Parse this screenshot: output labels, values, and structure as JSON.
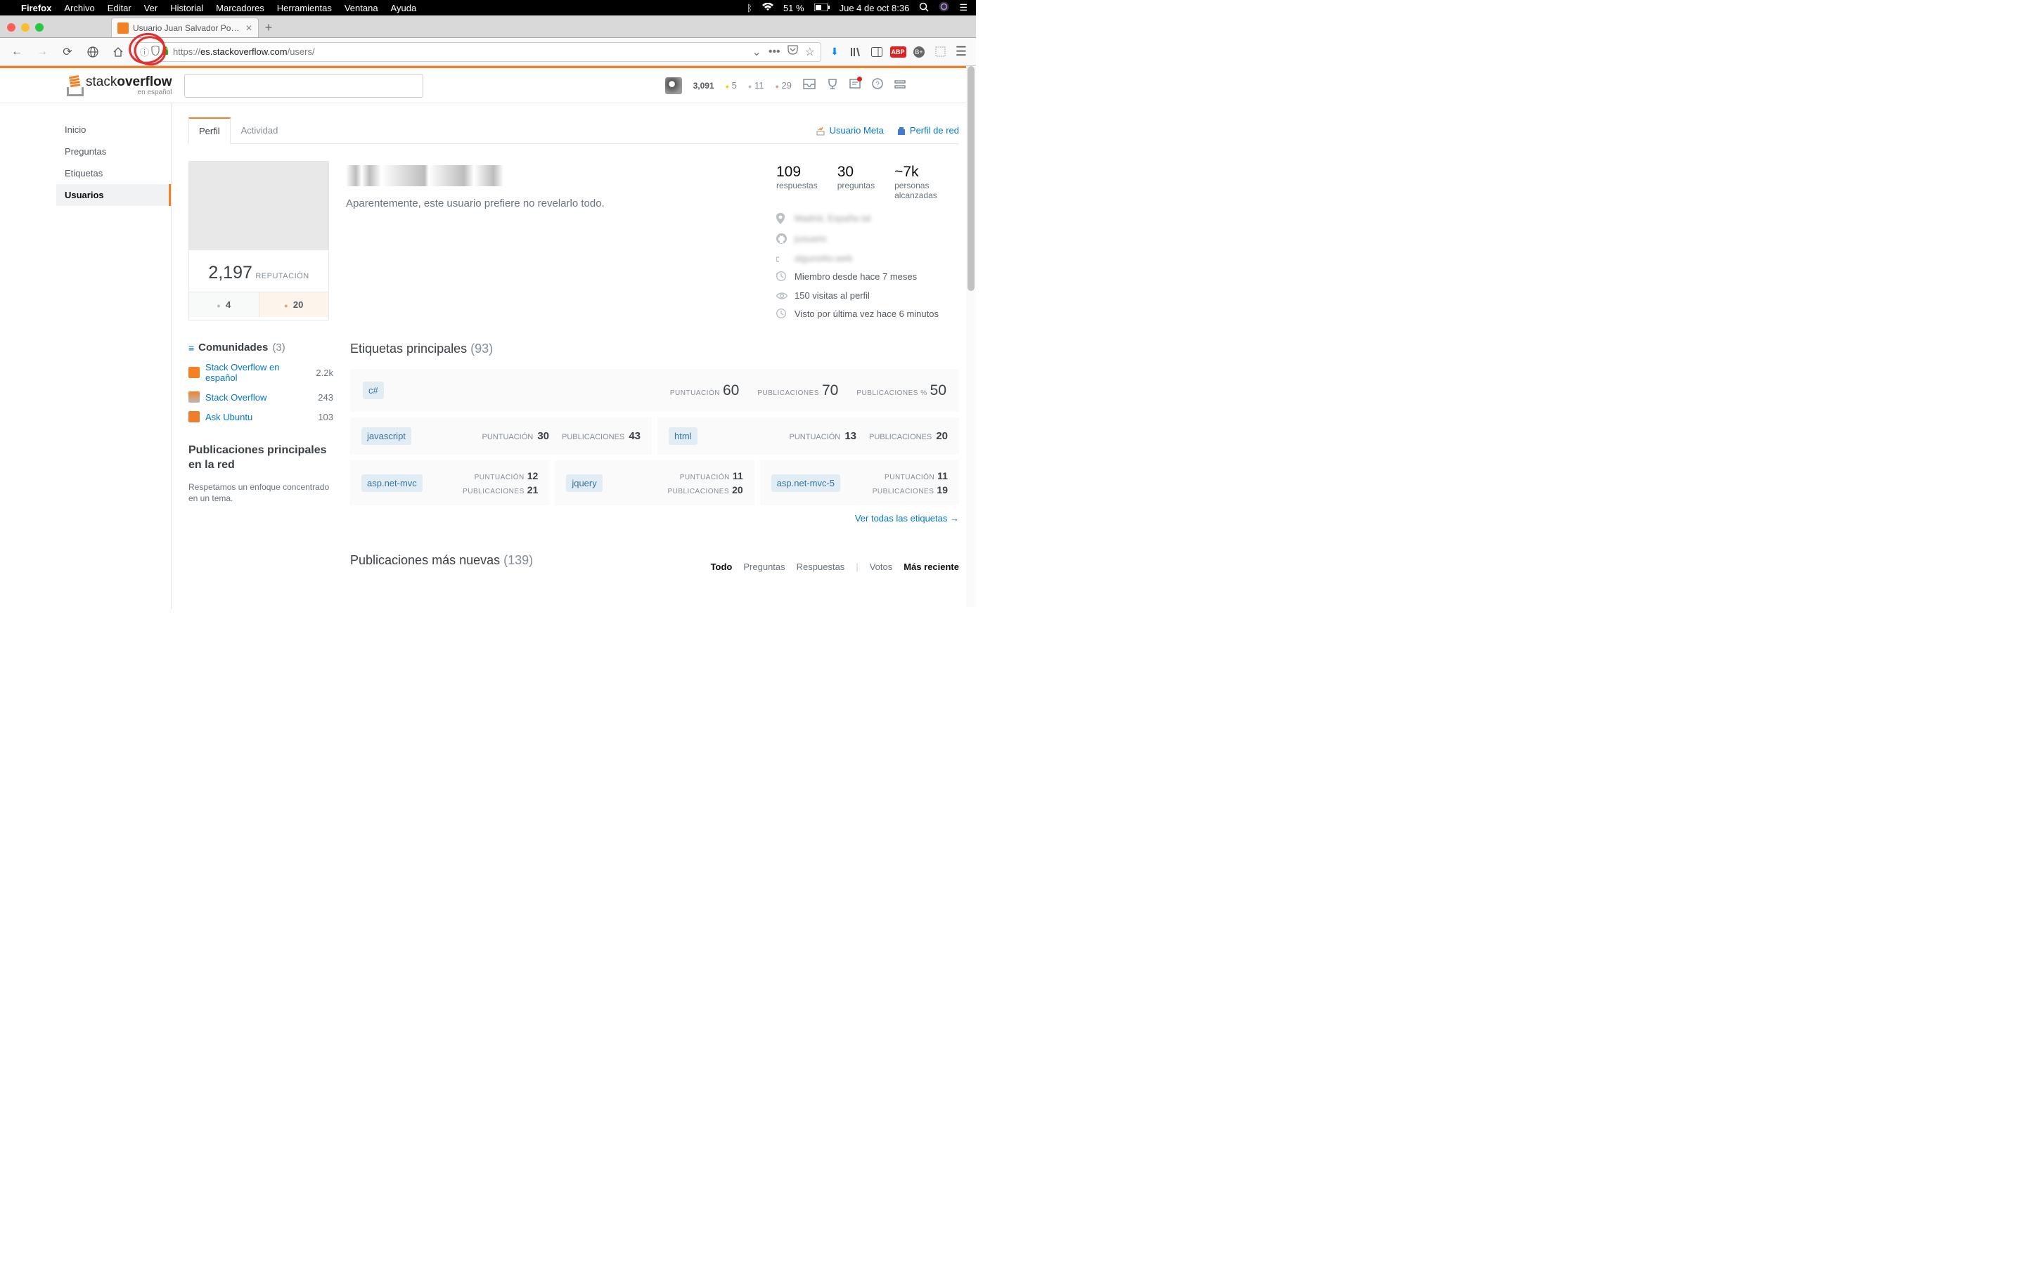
{
  "menubar": {
    "app": "Firefox",
    "menus": [
      "Archivo",
      "Editar",
      "Ver",
      "Historial",
      "Marcadores",
      "Herramientas",
      "Ventana",
      "Ayuda"
    ],
    "battery": "51 %",
    "datetime": "Jue 4 de oct  8:36"
  },
  "browser": {
    "tab_title": "Usuario Juan Salvador Portugal",
    "url_prefix": "https://",
    "url_domain": "es.stackoverflow.com",
    "url_path": "/users/"
  },
  "so_header": {
    "brand1": "stack",
    "brand2": "overflow",
    "sub": "en español",
    "rep": "3,091",
    "gold": "5",
    "silver": "11",
    "bronze": "29"
  },
  "sidebar": {
    "items": [
      "Inicio",
      "Preguntas",
      "Etiquetas",
      "Usuarios"
    ],
    "active": 3
  },
  "tabs": {
    "perfil": "Perfil",
    "actividad": "Actividad",
    "usuario_meta": "Usuario Meta",
    "perfil_red": "Perfil de red"
  },
  "profile": {
    "bio": "Aparentemente, este usuario prefiere no revelarlo todo.",
    "rep_num": "2,197",
    "rep_label": "REPUTACIÓN",
    "silver_badges": "4",
    "bronze_badges": "20"
  },
  "stats": {
    "respuestas_n": "109",
    "respuestas_l": "respuestas",
    "preguntas_n": "30",
    "preguntas_l": "preguntas",
    "alcance_n": "~7k",
    "alcance_l": "personas alcanzadas",
    "miembro": "Miembro desde hace 7 meses",
    "visitas": "150 visitas al perfil",
    "ultima": "Visto por última vez hace 6 minutos"
  },
  "communities": {
    "title": "Comunidades",
    "count": "(3)",
    "items": [
      {
        "name": "Stack Overflow en español",
        "rep": "2.2k"
      },
      {
        "name": "Stack Overflow",
        "rep": "243"
      },
      {
        "name": "Ask Ubuntu",
        "rep": "103"
      }
    ],
    "pub_title": "Publicaciones principales en la red",
    "pub_note": "Respetamos un enfoque concentrado en un tema."
  },
  "top_tags": {
    "title": "Etiquetas principales",
    "count": "(93)",
    "lbl_punt": "Puntuación",
    "lbl_pub": "Publicaciones",
    "lbl_pubpct": "Publicaciones %",
    "main": {
      "tag": "c#",
      "score": "60",
      "posts": "70",
      "pct": "50"
    },
    "row2": [
      {
        "tag": "javascript",
        "score": "30",
        "posts": "43"
      },
      {
        "tag": "html",
        "score": "13",
        "posts": "20"
      }
    ],
    "row3": [
      {
        "tag": "asp.net-mvc",
        "score": "12",
        "posts": "21"
      },
      {
        "tag": "jquery",
        "score": "11",
        "posts": "20"
      },
      {
        "tag": "asp.net-mvc-5",
        "score": "11",
        "posts": "19"
      }
    ],
    "see_all": "Ver todas las etiquetas →"
  },
  "newest": {
    "title": "Publicaciones más nuevas",
    "count": "(139)",
    "filters": [
      "Todo",
      "Preguntas",
      "Respuestas"
    ],
    "sorts": [
      "Votos",
      "Más reciente"
    ]
  }
}
